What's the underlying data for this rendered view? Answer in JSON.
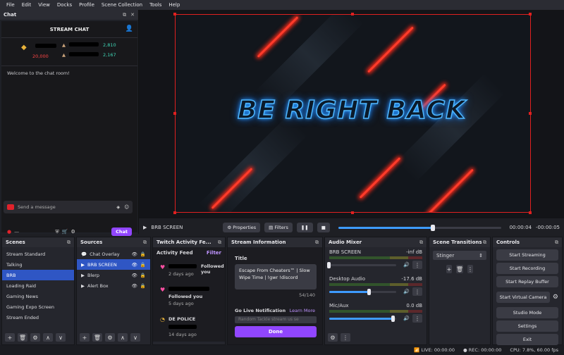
{
  "menu": [
    "File",
    "Edit",
    "View",
    "Docks",
    "Profile",
    "Scene Collection",
    "Tools",
    "Help"
  ],
  "chat": {
    "dock_title": "Chat",
    "header": "STREAM CHAT",
    "leader_left_value": "20,000",
    "leader_right_values": [
      "2,810",
      "2,167"
    ],
    "welcome": "Welcome to the chat room!",
    "send_placeholder": "Send a message",
    "chat_button": "Chat"
  },
  "preview": {
    "brb_text": "BE RIGHT BACK"
  },
  "transport": {
    "scene_label": "BRB SCREEN",
    "properties": "Properties",
    "filters": "Filters",
    "time": "00:00:04",
    "remaining": "-00:00:05",
    "progress_fraction": 0.58
  },
  "scenes": {
    "title": "Scenes",
    "items": [
      "Stream Standard",
      "Talking",
      "BRB",
      "Loading Raid",
      "Gaming News",
      "Gaming Expo Screen",
      "Stream Ended"
    ],
    "selected": 2
  },
  "sources": {
    "title": "Sources",
    "items": [
      "Chat Overlay",
      "BRB SCREEN",
      "Blerp",
      "Alert Box"
    ],
    "selected": 1
  },
  "activity": {
    "title": "Twitch Activity Fe...",
    "feed_label": "Activity Feed",
    "filter": "Filter",
    "items": [
      {
        "text": "Followed you",
        "time": "2 days ago"
      },
      {
        "text": "Followed you",
        "time": "5 days ago"
      },
      {
        "name": "DE POLICE",
        "time": "14 days ago"
      }
    ]
  },
  "stream_info": {
    "title": "Stream Information",
    "field_label": "Title",
    "title_value": "Escape From Cheaters™ | Slow Wipe Time | !gwr !discord",
    "counter": "54/140",
    "notif_label": "Go Live Notification",
    "learn_more": "Learn More",
    "notif_placeholder": "Random Tackle stream us se",
    "done": "Done"
  },
  "mixer": {
    "title": "Audio Mixer",
    "channels": [
      {
        "name": "BRB SCREEN",
        "db": "-inf dB",
        "level": 0.0
      },
      {
        "name": "Desktop Audio",
        "db": "-17.6 dB",
        "level": 0.6
      },
      {
        "name": "Mic/Aux",
        "db": "0.0 dB",
        "level": 0.95
      }
    ]
  },
  "transitions": {
    "title": "Scene Transitions",
    "value": "Stinger"
  },
  "controls": {
    "title": "Controls",
    "buttons": [
      "Start Streaming",
      "Start Recording",
      "Start Replay Buffer",
      "Start Virtual Camera",
      "Studio Mode",
      "Settings",
      "Exit"
    ]
  },
  "status": {
    "live": "LIVE: 00:00:00",
    "rec": "REC: 00:00:00",
    "cpu": "CPU: 7.8%, 60.00 fps"
  }
}
